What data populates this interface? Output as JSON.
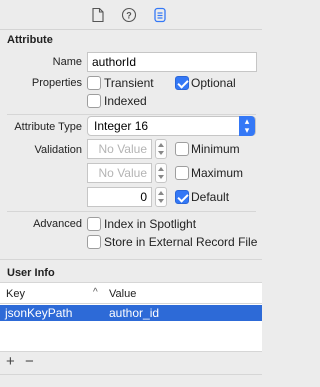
{
  "toolbar": {
    "icons": [
      "file-inspector-icon",
      "quick-help-icon",
      "data-model-inspector-icon"
    ]
  },
  "attribute": {
    "section_title": "Attribute",
    "name_label": "Name",
    "name_value": "authorId",
    "properties_label": "Properties",
    "transient_label": "Transient",
    "transient_checked": false,
    "optional_label": "Optional",
    "optional_checked": true,
    "indexed_label": "Indexed",
    "indexed_checked": false,
    "type_label": "Attribute Type",
    "type_value": "Integer 16",
    "validation_label": "Validation",
    "min_placeholder": "No Value",
    "min_label": "Minimum",
    "min_checked": false,
    "max_placeholder": "No Value",
    "max_label": "Maximum",
    "max_checked": false,
    "default_value": "0",
    "default_label": "Default",
    "default_checked": true,
    "advanced_label": "Advanced",
    "spotlight_label": "Index in Spotlight",
    "spotlight_checked": false,
    "external_label": "Store in External Record File",
    "external_checked": false
  },
  "user_info": {
    "section_title": "User Info",
    "columns": [
      "Key",
      "Value"
    ],
    "rows": [
      {
        "key": "jsonKeyPath",
        "value": "author_id",
        "selected": true
      }
    ],
    "add_label": "+",
    "remove_label": "−"
  },
  "colors": {
    "accent": "#3478f6",
    "selection": "#2d6ad7"
  }
}
